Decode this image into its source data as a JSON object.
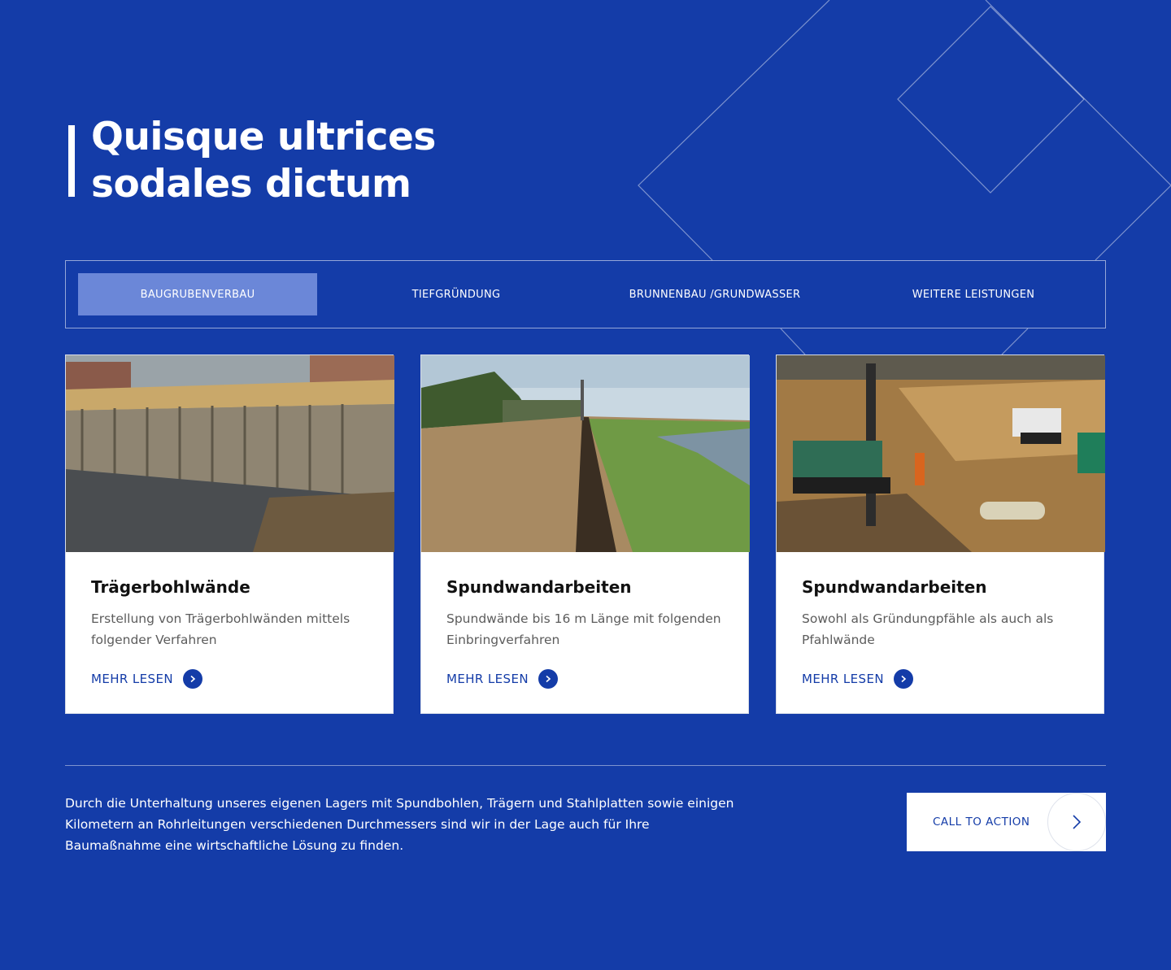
{
  "colors": {
    "background": "#143ca8",
    "active_tab": "#6b87d8",
    "card_background": "#ffffff",
    "accent": "#143ca8"
  },
  "heading": {
    "line1": "Quisque ultrices",
    "line2": "sodales dictum"
  },
  "tabs": [
    {
      "label": "BAUGRUBENVERBAU",
      "active": true
    },
    {
      "label": "TIEFGRÜNDUNG",
      "active": false
    },
    {
      "label": "BRUNNENBAU /GRUNDWASSER",
      "active": false
    },
    {
      "label": "WEITERE LEISTUNGEN",
      "active": false
    }
  ],
  "cards": [
    {
      "title": "Trägerbohlwände",
      "description": "Erstellung von Trägerbohlwänden mittels folgender Verfahren",
      "link": "MEHR LESEN",
      "icon": "chevron-right-icon"
    },
    {
      "title": "Spundwandarbeiten",
      "description": "Spundwände bis 16 m Länge mit folgenden Einbringverfahren",
      "link": "MEHR LESEN",
      "icon": "chevron-right-icon"
    },
    {
      "title": "Spundwandarbeiten",
      "description": "Sowohl als Gründungpfähle als auch als Pfahlwände",
      "link": "MEHR LESEN",
      "icon": "chevron-right-icon"
    }
  ],
  "footer": {
    "text": "Durch die Unterhaltung unseres eigenen Lagers mit Spundbohlen, Trägern und Stahlplatten sowie einigen Kilometern an Rohrleitungen verschiedenen Durchmessers sind wir in der Lage auch für Ihre Baumaßnahme eine wirtschaftliche Lösung zu finden.",
    "cta_label": "CALL TO ACTION",
    "cta_icon": "chevron-right-icon"
  }
}
